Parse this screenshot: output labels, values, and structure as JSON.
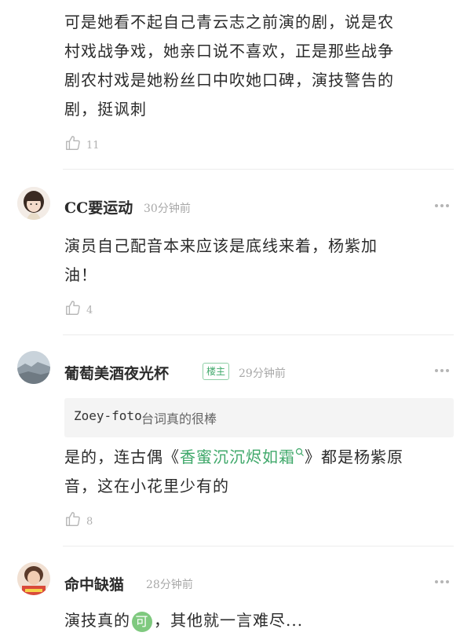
{
  "comments": [
    {
      "text_lines": [
        "可是她看不起自己青云志之前演的剧，说是农",
        "村戏战争戏，她亲口说不喜欢，正是那些战争",
        "剧农村戏是她粉丝口中吹她口碑，演技警告的",
        "剧，挺讽刺"
      ],
      "likes": "11"
    },
    {
      "username": "CC要运动",
      "time": "30分钟前",
      "text_lines": [
        "演员自己配音本来应该是底线来着，杨紫加",
        "油！"
      ],
      "likes": "4"
    },
    {
      "username": "葡萄美酒夜光杯",
      "badge": "楼主",
      "time": "29分钟前",
      "quote_user": "Zoey-foto",
      "quote_text": "台词真的很棒",
      "text_line1_pre": "是的，连古偶《",
      "text_link": "香蜜沉沉烬如霜",
      "text_line1_post": "》都是杨紫原",
      "text_line2": "音，这在小花里少有的",
      "likes": "8"
    },
    {
      "username": "命中缺猫",
      "time": "28分钟前",
      "text_pre": "演技真的",
      "emoji": "可",
      "text_post": "，其他就一言难尽..."
    }
  ],
  "colors": {
    "accent": "#3fa86a",
    "muted": "#a8a8a8"
  }
}
